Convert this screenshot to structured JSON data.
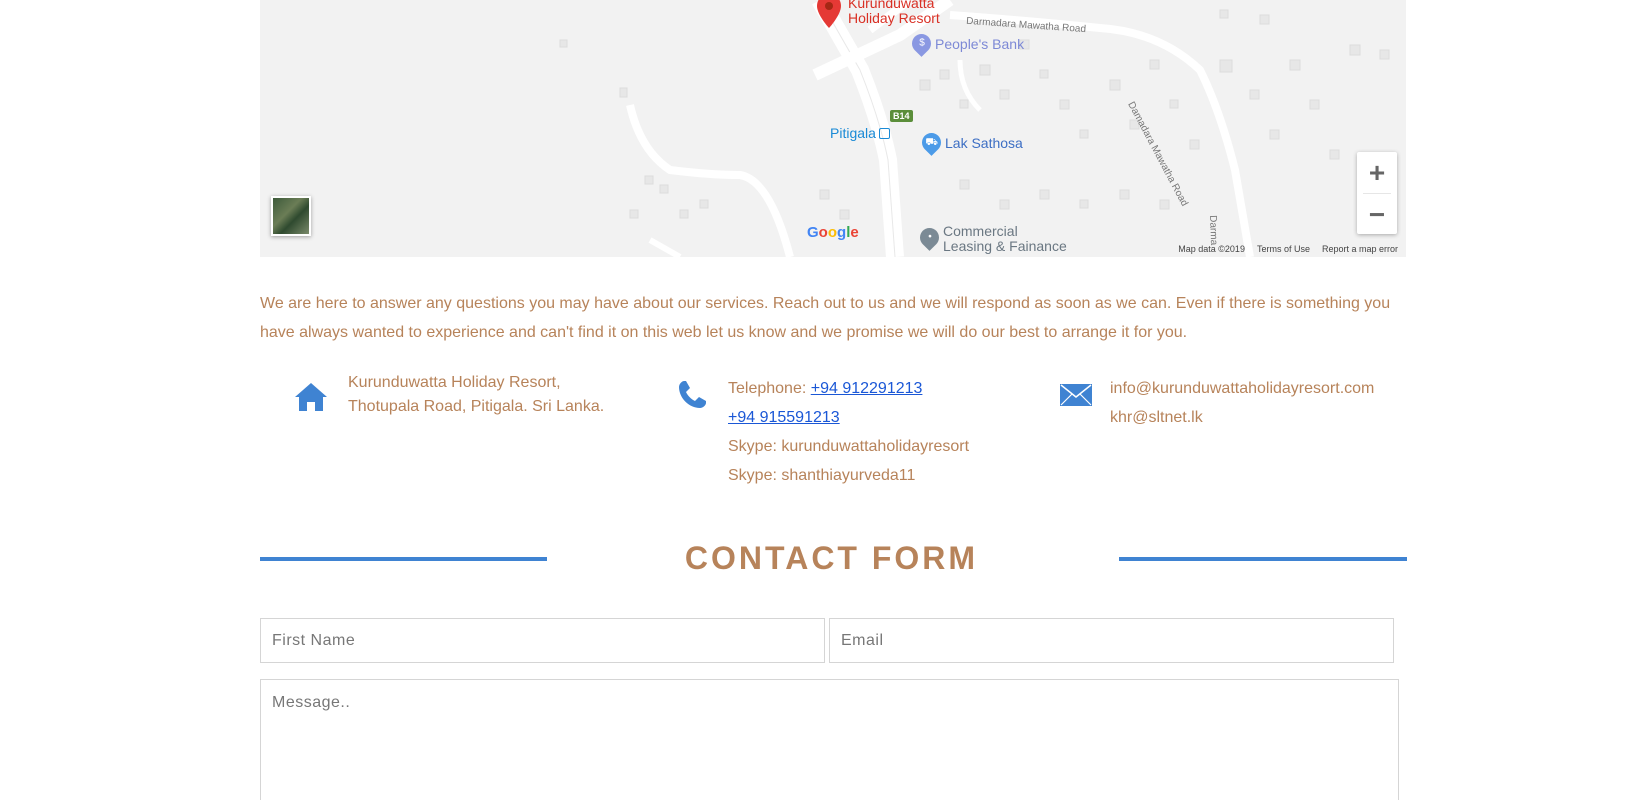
{
  "map": {
    "pin_label_line1": "Kurunduwatta",
    "pin_label_line2": "Holiday Resort",
    "pois": {
      "peoples_bank": "People's Bank",
      "pitigala": "Pitigala",
      "lak_sathosa": "Lak Sathosa",
      "commercial_line1": "Commercial",
      "commercial_line2": "Leasing & Fainance"
    },
    "road_labels": {
      "darmadara_top": "Darmadara Mawatha Road",
      "damadara_right": "Damadara Mawatha Road",
      "damadara_edge": "Darma"
    },
    "route_shield": "B14",
    "google_logo": [
      "G",
      "o",
      "o",
      "g",
      "l",
      "e"
    ],
    "footer": {
      "map_data": "Map data ©2019",
      "terms": "Terms of Use",
      "report": "Report a map error"
    },
    "zoom": {
      "plus": "+",
      "minus": "−"
    }
  },
  "intro_text": "We are here to answer any questions you may have about our services. Reach out to us and we will respond as soon as we can. Even if there is something you have always wanted to experience and can't find it on this web let us know and we promise we will do our best to arrange it for you.",
  "contact": {
    "address": {
      "icon": "home-icon",
      "line1": "Kurunduwatta Holiday Resort,",
      "line2": "Thotupala Road, Pitigala. Sri Lanka."
    },
    "phone": {
      "icon": "phone-icon",
      "telephone_label": "Telephone: ",
      "telephone_1": "+94 912291213",
      "telephone_2": "+94 915591213",
      "skype_1": "Skype: kurunduwattaholidayresort",
      "skype_2": "Skype: shanthiayurveda11"
    },
    "email": {
      "icon": "envelope-icon",
      "email_1": "info@kurunduwattaholidayresort.com",
      "email_2": "khr@sltnet.lk"
    }
  },
  "contact_form": {
    "title": "CONTACT FORM",
    "first_name_placeholder": "First Name",
    "email_placeholder": "Email",
    "message_placeholder": "Message.."
  },
  "colors": {
    "text_brown": "#b7835a",
    "accent_blue": "#3f83d2",
    "link_blue": "#1a57d6",
    "pin_red": "#d93025"
  }
}
